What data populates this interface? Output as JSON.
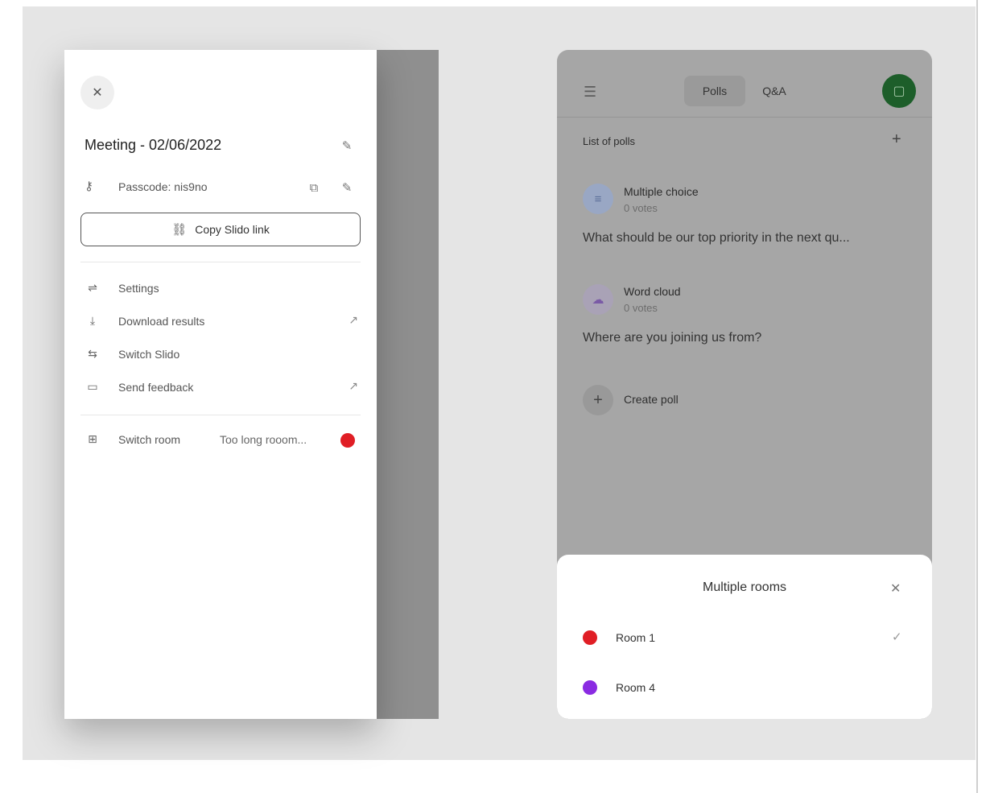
{
  "drawer": {
    "close_icon": "close-icon",
    "meeting_title": "Meeting - 02/06/2022",
    "passcode_label": "Passcode: nis9no",
    "copy_link_label": "Copy Slido link",
    "menu": [
      {
        "icon": "sliders-icon",
        "label": "Settings"
      },
      {
        "icon": "download-icon",
        "label": "Download results"
      },
      {
        "icon": "switch-icon",
        "label": "Switch Slido"
      },
      {
        "icon": "feedback-icon",
        "label": "Send feedback"
      }
    ],
    "switch_room": {
      "label": "Switch room",
      "room_name": "Too long rooom...",
      "room_color": "#e01e25"
    }
  },
  "panel": {
    "tabs": [
      "Polls",
      "Q&A"
    ],
    "active_tab": "Polls",
    "list_title": "List of polls",
    "polls": [
      {
        "type": "Multiple choice",
        "votes": "0 votes",
        "question": "What should be our top priority in the next qu...",
        "icon": "list-icon",
        "icon_bg": "#99a7c4"
      },
      {
        "type": "Word cloud",
        "votes": "0 votes",
        "question": "Where are you joining us from?",
        "icon": "cloud-icon",
        "icon_bg": "#a9a2b6"
      }
    ],
    "create_label": "Create poll",
    "avatar_color": "#1d5e2a"
  },
  "rooms_sheet": {
    "title": "Multiple rooms",
    "rooms": [
      {
        "name": "Room 1",
        "color": "#e01e25",
        "selected": true
      },
      {
        "name": "Room 4",
        "color": "#8a2be2",
        "selected": false
      }
    ]
  }
}
